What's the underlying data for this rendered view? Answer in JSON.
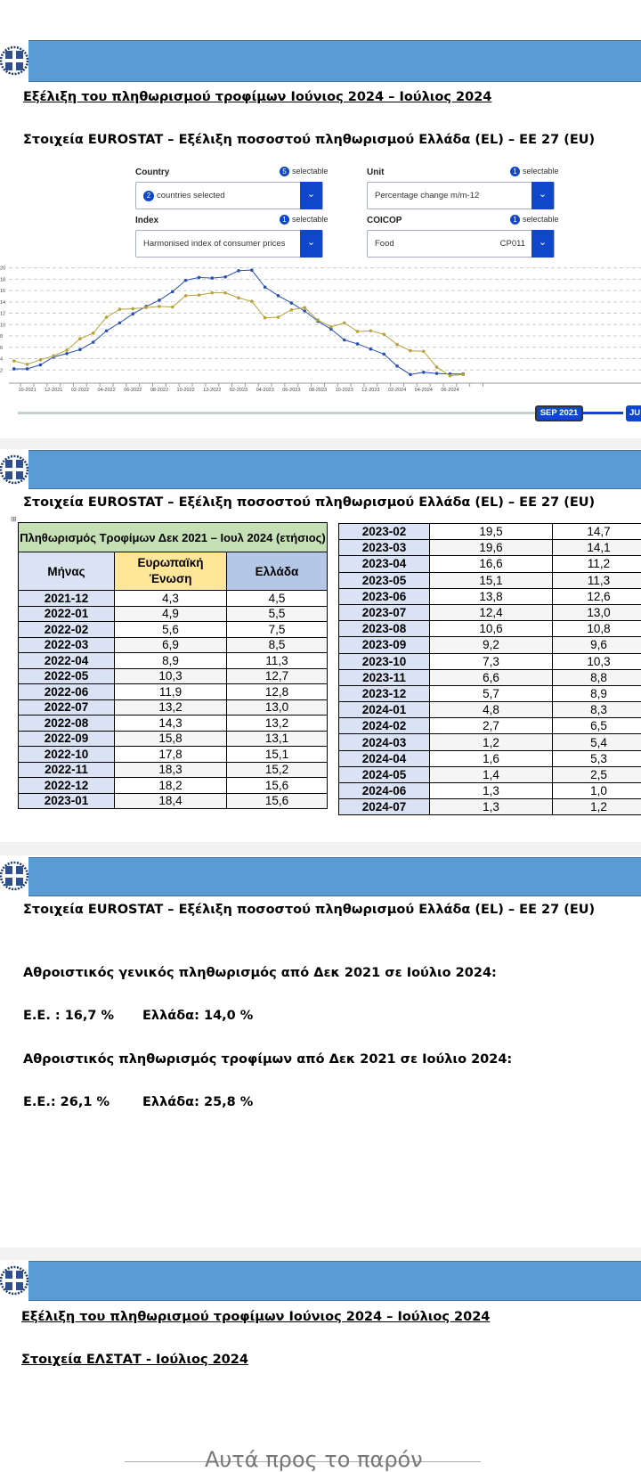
{
  "slide1": {
    "title": "Εξέλιξη του πληθωρισμού τροφίμων Ιούνιος 2024 – Ιούλιος 2024",
    "subtitle": "Στοιχεία EUROSTAT – Εξέλιξη ποσοστού πληθωρισμού Ελλάδα (EL) – ΕΕ 27 (EU)",
    "filters": {
      "country": {
        "label": "Country",
        "count": "5",
        "selectable": "selectable",
        "value_count": "2",
        "value": "countries selected"
      },
      "unit": {
        "label": "Unit",
        "count": "1",
        "selectable": "selectable",
        "value": "Percentage change m/m-12"
      },
      "index": {
        "label": "Index",
        "count": "1",
        "selectable": "selectable",
        "value": "Harmonised index of consumer prices"
      },
      "coicop": {
        "label": "COICOP",
        "count": "1",
        "selectable": "selectable",
        "value": "Food",
        "code": "CP011"
      }
    },
    "slider": {
      "start": "SEP 2021",
      "end": "JU"
    }
  },
  "chart_data": {
    "type": "line",
    "x_start": "2021-09",
    "x_end": "2024-07",
    "ylim": [
      0,
      20
    ],
    "grid": true,
    "yticks": [
      "2",
      "4",
      "6",
      "8",
      "10",
      "12",
      "14",
      "16",
      "18",
      "20"
    ],
    "xticks": [
      "10-2021",
      "12-2021",
      "02-2022",
      "04-2022",
      "06-2022",
      "08-2022",
      "10-2022",
      "12-2022",
      "02-2023",
      "04-2023",
      "06-2023",
      "08-2023",
      "10-2023",
      "12-2023",
      "02-2024",
      "04-2024",
      "06-2024"
    ],
    "series": [
      {
        "color": "#2a4fb5",
        "values": [
          2.2,
          2.2,
          2.9,
          4.3,
          4.9,
          5.6,
          6.9,
          8.9,
          10.3,
          11.9,
          13.2,
          14.3,
          15.8,
          17.8,
          18.3,
          18.2,
          18.4,
          19.5,
          19.6,
          16.6,
          15.1,
          13.8,
          12.4,
          10.6,
          9.2,
          7.3,
          6.6,
          5.7,
          4.8,
          2.7,
          1.2,
          1.6,
          1.4,
          1.3,
          1.3
        ]
      },
      {
        "color": "#b8a23a",
        "values": [
          3.6,
          3.0,
          3.8,
          4.5,
          5.5,
          7.5,
          8.5,
          11.3,
          12.7,
          12.8,
          13.0,
          13.2,
          13.1,
          15.1,
          15.2,
          15.6,
          15.6,
          14.7,
          14.1,
          11.2,
          11.3,
          12.6,
          13.0,
          10.8,
          9.6,
          10.3,
          8.8,
          8.9,
          8.3,
          6.5,
          5.4,
          5.3,
          2.5,
          1.0,
          1.2
        ]
      }
    ]
  },
  "slide2": {
    "subtitle": "Στοιχεία EUROSTAT – Εξέλιξη ποσοστού πληθωρισμού Ελλάδα (EL) – ΕΕ 27 (EU)",
    "table": {
      "title": "Πληθωρισμός Τροφίμων Δεκ 2021 – Ιουλ 2024 (ετήσιος)",
      "headers": [
        "Μήνας",
        "Ευρωπαϊκή Ένωση",
        "Ελλάδα"
      ],
      "rows_left": [
        [
          "2021-12",
          "4,3",
          "4,5"
        ],
        [
          "2022-01",
          "4,9",
          "5,5"
        ],
        [
          "2022-02",
          "5,6",
          "7,5"
        ],
        [
          "2022-03",
          "6,9",
          "8,5"
        ],
        [
          "2022-04",
          "8,9",
          "11,3"
        ],
        [
          "2022-05",
          "10,3",
          "12,7"
        ],
        [
          "2022-06",
          "11,9",
          "12,8"
        ],
        [
          "2022-07",
          "13,2",
          "13,0"
        ],
        [
          "2022-08",
          "14,3",
          "13,2"
        ],
        [
          "2022-09",
          "15,8",
          "13,1"
        ],
        [
          "2022-10",
          "17,8",
          "15,1"
        ],
        [
          "2022-11",
          "18,3",
          "15,2"
        ],
        [
          "2022-12",
          "18,2",
          "15,6"
        ],
        [
          "2023-01",
          "18,4",
          "15,6"
        ]
      ],
      "rows_right": [
        [
          "2023-02",
          "19,5",
          "14,7"
        ],
        [
          "2023-03",
          "19,6",
          "14,1"
        ],
        [
          "2023-04",
          "16,6",
          "11,2"
        ],
        [
          "2023-05",
          "15,1",
          "11,3"
        ],
        [
          "2023-06",
          "13,8",
          "12,6"
        ],
        [
          "2023-07",
          "12,4",
          "13,0"
        ],
        [
          "2023-08",
          "10,6",
          "10,8"
        ],
        [
          "2023-09",
          "9,2",
          "9,6"
        ],
        [
          "2023-10",
          "7,3",
          "10,3"
        ],
        [
          "2023-11",
          "6,6",
          "8,8"
        ],
        [
          "2023-12",
          "5,7",
          "8,9"
        ],
        [
          "2024-01",
          "4,8",
          "8,3"
        ],
        [
          "2024-02",
          "2,7",
          "6,5"
        ],
        [
          "2024-03",
          "1,2",
          "5,4"
        ],
        [
          "2024-04",
          "1,6",
          "5,3"
        ],
        [
          "2024-05",
          "1,4",
          "2,5"
        ],
        [
          "2024-06",
          "1,3",
          "1,0"
        ],
        [
          "2024-07",
          "1,3",
          "1,2"
        ]
      ]
    }
  },
  "slide3": {
    "subtitle": "Στοιχεία EUROSTAT – Εξέλιξη ποσοστού πληθωρισμού Ελλάδα (EL) – ΕΕ 27 (EU)",
    "line1": "Αθροιστικός γενικός πληθωρισμός από Δεκ 2021 σε Ιούλιο 2024:",
    "eu_general": "Ε.Ε. : 16,7 %",
    "gr_general": "Ελλάδα: 14,0 %",
    "line2": "Αθροιστικός πληθωρισμός τροφίμων από Δεκ 2021 σε Ιούλιο 2024:",
    "eu_food": "Ε.Ε.: 26,1 %",
    "gr_food": "Ελλάδα: 25,8 %"
  },
  "slide4": {
    "title": "Εξέλιξη του πληθωρισμού τροφίμων Ιούνιος 2024 – Ιούλιος 2024",
    "subtitle": "Στοιχεία ΕΛΣΤΑΤ - Ιούλιος 2024",
    "closing": "Αυτά προς το παρόν"
  }
}
